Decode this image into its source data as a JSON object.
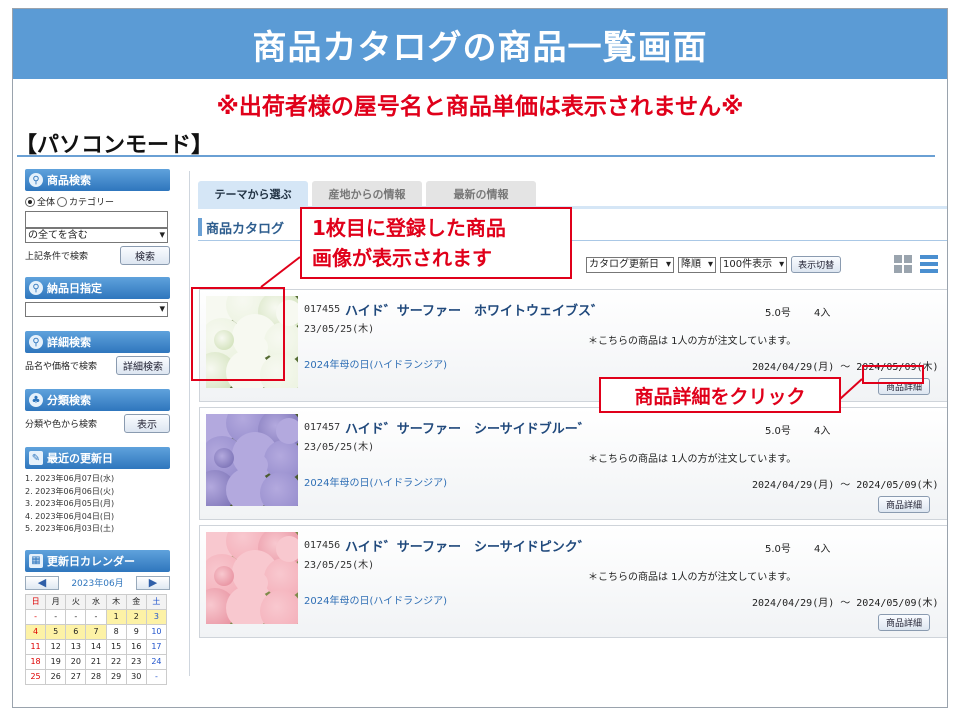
{
  "slide": {
    "title": "商品カタログの商品一覧画面",
    "notice": "※出荷者様の屋号名と商品単価は表示されません※",
    "mode_label": "【パソコンモード】"
  },
  "sidebar": {
    "search": {
      "heading": "商品検索",
      "radio_all": "全体",
      "radio_category": "カテゴリー",
      "keyword_value": "",
      "match_select": "の全てを含む",
      "cond_label": "上記条件で検索",
      "button": "検索"
    },
    "delivery": {
      "heading": "納品日指定",
      "select": ""
    },
    "detail": {
      "heading": "詳細検索",
      "label": "品名や価格で検索",
      "button": "詳細検索"
    },
    "category": {
      "heading": "分類検索",
      "label": "分類や色から検索",
      "button": "表示"
    },
    "recent": {
      "heading": "最近の更新日",
      "items": [
        "1. 2023年06月07日(水)",
        "2. 2023年06月06日(火)",
        "3. 2023年06月05日(月)",
        "4. 2023年06月04日(日)",
        "5. 2023年06月03日(土)"
      ]
    },
    "calendar": {
      "heading": "更新日カレンダー",
      "month": "2023年06月",
      "weekdays": [
        "日",
        "月",
        "火",
        "水",
        "木",
        "金",
        "土"
      ],
      "rows": [
        [
          "-",
          "-",
          "-",
          "-",
          "1",
          "2",
          "3"
        ],
        [
          "4",
          "5",
          "6",
          "7",
          "8",
          "9",
          "10"
        ],
        [
          "11",
          "12",
          "13",
          "14",
          "15",
          "16",
          "17"
        ],
        [
          "18",
          "19",
          "20",
          "21",
          "22",
          "23",
          "24"
        ],
        [
          "25",
          "26",
          "27",
          "28",
          "29",
          "30",
          "-"
        ]
      ],
      "highlighted": [
        "1",
        "2",
        "3",
        "4",
        "5",
        "6",
        "7"
      ]
    }
  },
  "main": {
    "tabs": [
      {
        "label": "テーマから選ぶ",
        "active": true
      },
      {
        "label": "産地からの情報",
        "active": false
      },
      {
        "label": "最新の情報",
        "active": false
      }
    ],
    "section_title": "商品カタログ",
    "sort": {
      "order_by": "カタログ更新日",
      "direction": "降順",
      "per_page": "100件表示",
      "switch_button": "表示切替"
    },
    "products": [
      {
        "code": "017455",
        "name": "ハイド゛サーファー　ホワイトウェイブス゛",
        "date": "23/05/25(木)",
        "size": "5.0号",
        "qty": "4入",
        "order_note": "＊こちらの商品は 1人の方が注文しています。",
        "event": "2024年母の日(ハイドランジア)",
        "period": "2024/04/29(月) 〜 2024/05/09(木)",
        "detail_button": "商品詳細",
        "colors": [
          "#e9f1dc",
          "#f7f9f1",
          "#c9dcae",
          "#556b33"
        ]
      },
      {
        "code": "017457",
        "name": "ハイド゛サーファー　シーサイドブルー゛",
        "date": "23/05/25(木)",
        "size": "5.0号",
        "qty": "4入",
        "order_note": "＊こちらの商品は 1人の方が注文しています。",
        "event": "2024年母の日(ハイドランジア)",
        "period": "2024/04/29(月) 〜 2024/05/09(木)",
        "detail_button": "商品詳細",
        "colors": [
          "#8f86c9",
          "#b3a9de",
          "#6f66ad",
          "#4b5b2f"
        ]
      },
      {
        "code": "017456",
        "name": "ハイド゛サーファー　シーサイドピンク゛",
        "date": "23/05/25(木)",
        "size": "5.0号",
        "qty": "4入",
        "order_note": "＊こちらの商品は 1人の方が注文しています。",
        "event": "2024年母の日(ハイドランジア)",
        "period": "2024/04/29(月) 〜 2024/05/09(木)",
        "detail_button": "商品詳細",
        "colors": [
          "#f3a9b4",
          "#f8c8cf",
          "#e48595",
          "#7e8a4a"
        ]
      }
    ]
  },
  "annotations": {
    "image_note_line1": "1枚目に登録した商品",
    "image_note_line2": "画像が表示されます",
    "detail_note": "商品詳細をクリック"
  },
  "colors": {
    "banner": "#5b9bd5",
    "accent_red": "#e0001a",
    "side_head": "#2f76bd"
  }
}
